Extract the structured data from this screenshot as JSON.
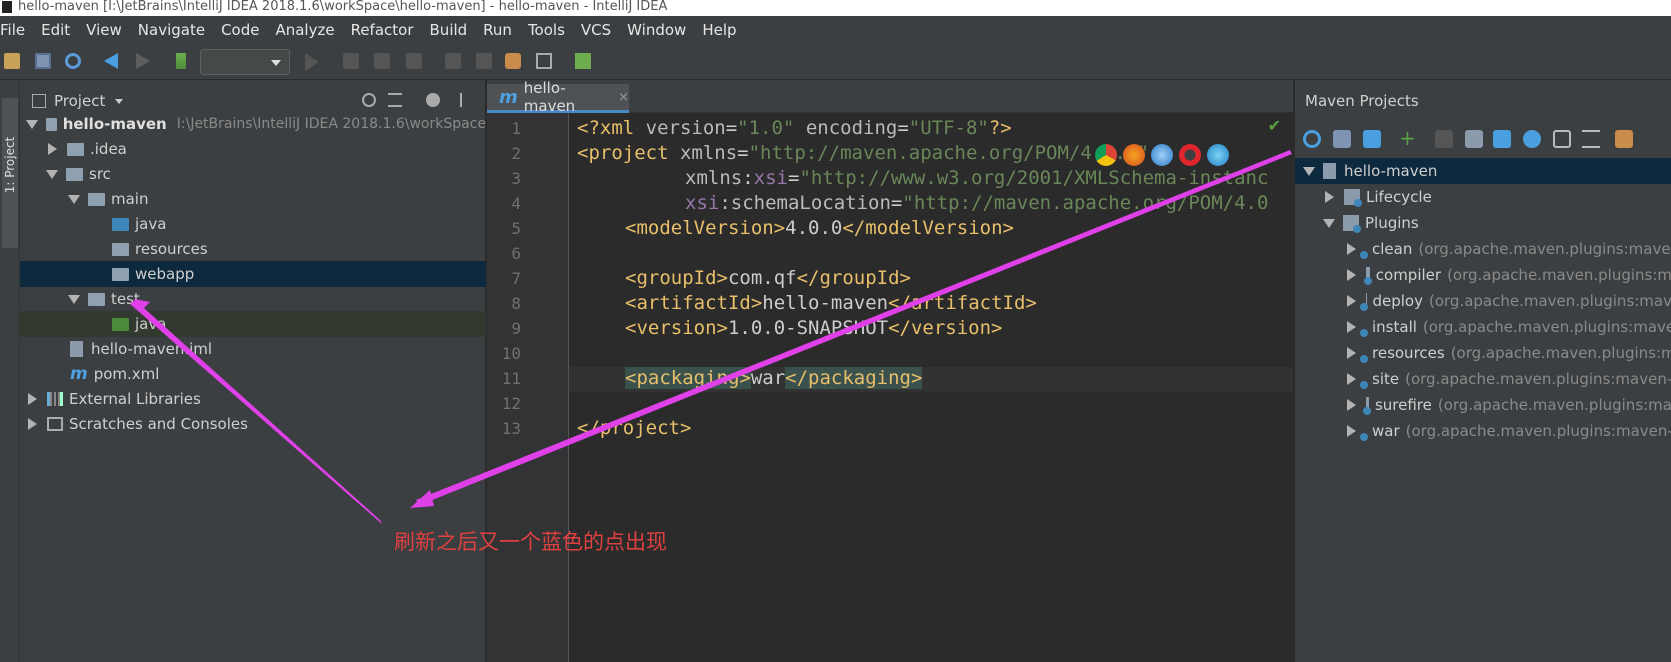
{
  "window": {
    "title": "hello-maven [I:\\JetBrains\\IntelliJ IDEA 2018.1.6\\workSpace\\hello-maven] - hello-maven - IntelliJ IDEA"
  },
  "menu": [
    "File",
    "Edit",
    "View",
    "Navigate",
    "Code",
    "Analyze",
    "Refactor",
    "Build",
    "Run",
    "Tools",
    "VCS",
    "Window",
    "Help"
  ],
  "left_strip": {
    "tab": "1: Project"
  },
  "project_panel": {
    "title": "Project",
    "tree": [
      {
        "label": "hello-maven",
        "detail": "I:\\JetBrains\\IntelliJ IDEA 2018.1.6\\workSpace"
      },
      {
        "label": ".idea"
      },
      {
        "label": "src"
      },
      {
        "label": "main"
      },
      {
        "label": "java"
      },
      {
        "label": "resources"
      },
      {
        "label": "webapp"
      },
      {
        "label": "test"
      },
      {
        "label": "java"
      },
      {
        "label": "hello-maven.iml"
      },
      {
        "label": "pom.xml"
      },
      {
        "label": "External Libraries"
      },
      {
        "label": "Scratches and Consoles"
      }
    ]
  },
  "editor": {
    "tab": "hello-maven",
    "tab_icon": "m",
    "tab_close": "×",
    "line_numbers": [
      "1",
      "2",
      "3",
      "4",
      "5",
      "6",
      "7",
      "8",
      "9",
      "10",
      "11",
      "12",
      "13"
    ],
    "lines": {
      "l1": {
        "a": "<?xml ",
        "b": "version",
        "c": "=",
        "d": "\"1.0\"",
        "e": " encoding",
        "f": "=",
        "g": "\"UTF-8\"",
        "h": "?>"
      },
      "l2": {
        "a": "<project ",
        "b": "xmlns",
        "c": "=",
        "d": "\"http://maven.apache.org/POM/4.0.0\""
      },
      "l3": {
        "a": "xmlns",
        "b": ":",
        "c": "xsi",
        "d": "=",
        "e": "\"http://www.w3.org/2001/XMLSchema-instanc"
      },
      "l4": {
        "a": "xsi",
        "b": ":schemaLocation",
        "c": "=",
        "d": "\"http://maven.apache.org/POM/4.0"
      },
      "l5": {
        "a": "<modelVersion>",
        "b": "4.0.0",
        "c": "</modelVersion>"
      },
      "l7": {
        "a": "<groupId>",
        "b": "com.qf",
        "c": "</groupId>"
      },
      "l8": {
        "a": "<artifactId>",
        "b": "hello-maven",
        "c": "</artifactId>"
      },
      "l9": {
        "a": "<version>",
        "b": "1.0.0-SNAPSHOT",
        "c": "</version>"
      },
      "l11": {
        "a": "<packaging>",
        "b": "war",
        "c": "</packaging>"
      },
      "l13": {
        "a": "</project>"
      }
    }
  },
  "maven_panel": {
    "title": "Maven Projects",
    "tree": [
      {
        "label": "hello-maven"
      },
      {
        "label": "Lifecycle"
      },
      {
        "label": "Plugins"
      },
      {
        "label": "clean",
        "detail": "(org.apache.maven.plugins:maven"
      },
      {
        "label": "compiler",
        "detail": "(org.apache.maven.plugins:m"
      },
      {
        "label": "deploy",
        "detail": "(org.apache.maven.plugins:mav"
      },
      {
        "label": "install",
        "detail": "(org.apache.maven.plugins:mave"
      },
      {
        "label": "resources",
        "detail": "(org.apache.maven.plugins:m"
      },
      {
        "label": "site",
        "detail": "(org.apache.maven.plugins:maven-"
      },
      {
        "label": "surefire",
        "detail": "(org.apache.maven.plugins:ma"
      },
      {
        "label": "war",
        "detail": "(org.apache.maven.plugins:maven-"
      }
    ]
  },
  "annotation": {
    "text": "刷新之后又一个蓝色的点出现",
    "color": "#e04040",
    "arrow_color": "#e040e8"
  }
}
